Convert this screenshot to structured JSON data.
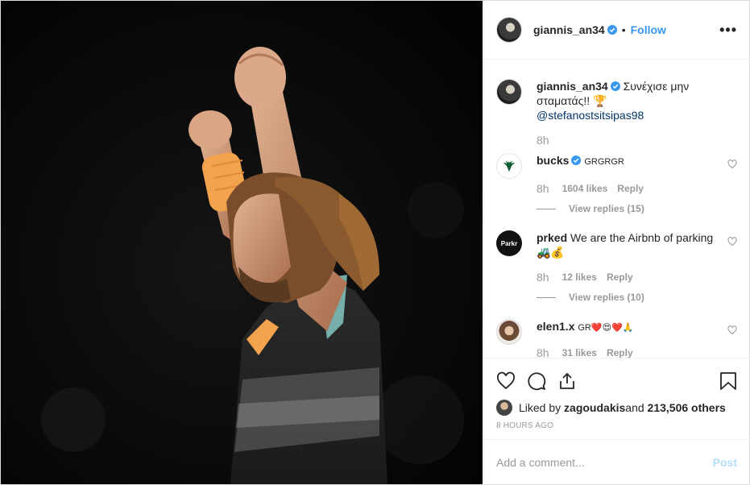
{
  "post": {
    "author": "giannis_an34",
    "follow_label": "Follow",
    "dot": "•",
    "more_label": "•••"
  },
  "caption": {
    "author": "giannis_an34",
    "text": "Συνέχισε μην σταματάς!! 🏆",
    "mention": "@stefanostsitsipas98",
    "time": "8h"
  },
  "comments": [
    {
      "author": "bucks",
      "verified": true,
      "text": "GRGRGR",
      "time": "8h",
      "likes": "1604 likes",
      "reply": "Reply",
      "view_replies": "View replies (15)"
    },
    {
      "author": "prked",
      "avatar_text": "Parkr",
      "text": "We are the Airbnb of parking🚜💰",
      "time": "8h",
      "likes": "12 likes",
      "reply": "Reply",
      "view_replies": "View replies (10)"
    },
    {
      "author": "elen1.x",
      "text": "GR❤️😍❤️🙏",
      "time": "8h",
      "likes": "31 likes",
      "reply": "Reply"
    }
  ],
  "likes_line": {
    "prefix": "Liked by ",
    "user": "zagoudakis",
    "middle": " and ",
    "count": "213,506 others"
  },
  "timestamp": "8 HOURS AGO",
  "add_comment": {
    "placeholder": "Add a comment...",
    "post_label": "Post"
  },
  "colors": {
    "accent": "#3897f0",
    "verified": "#3897f0",
    "post_disabled": "#b2dffc",
    "wristband": "#f3a24e"
  }
}
